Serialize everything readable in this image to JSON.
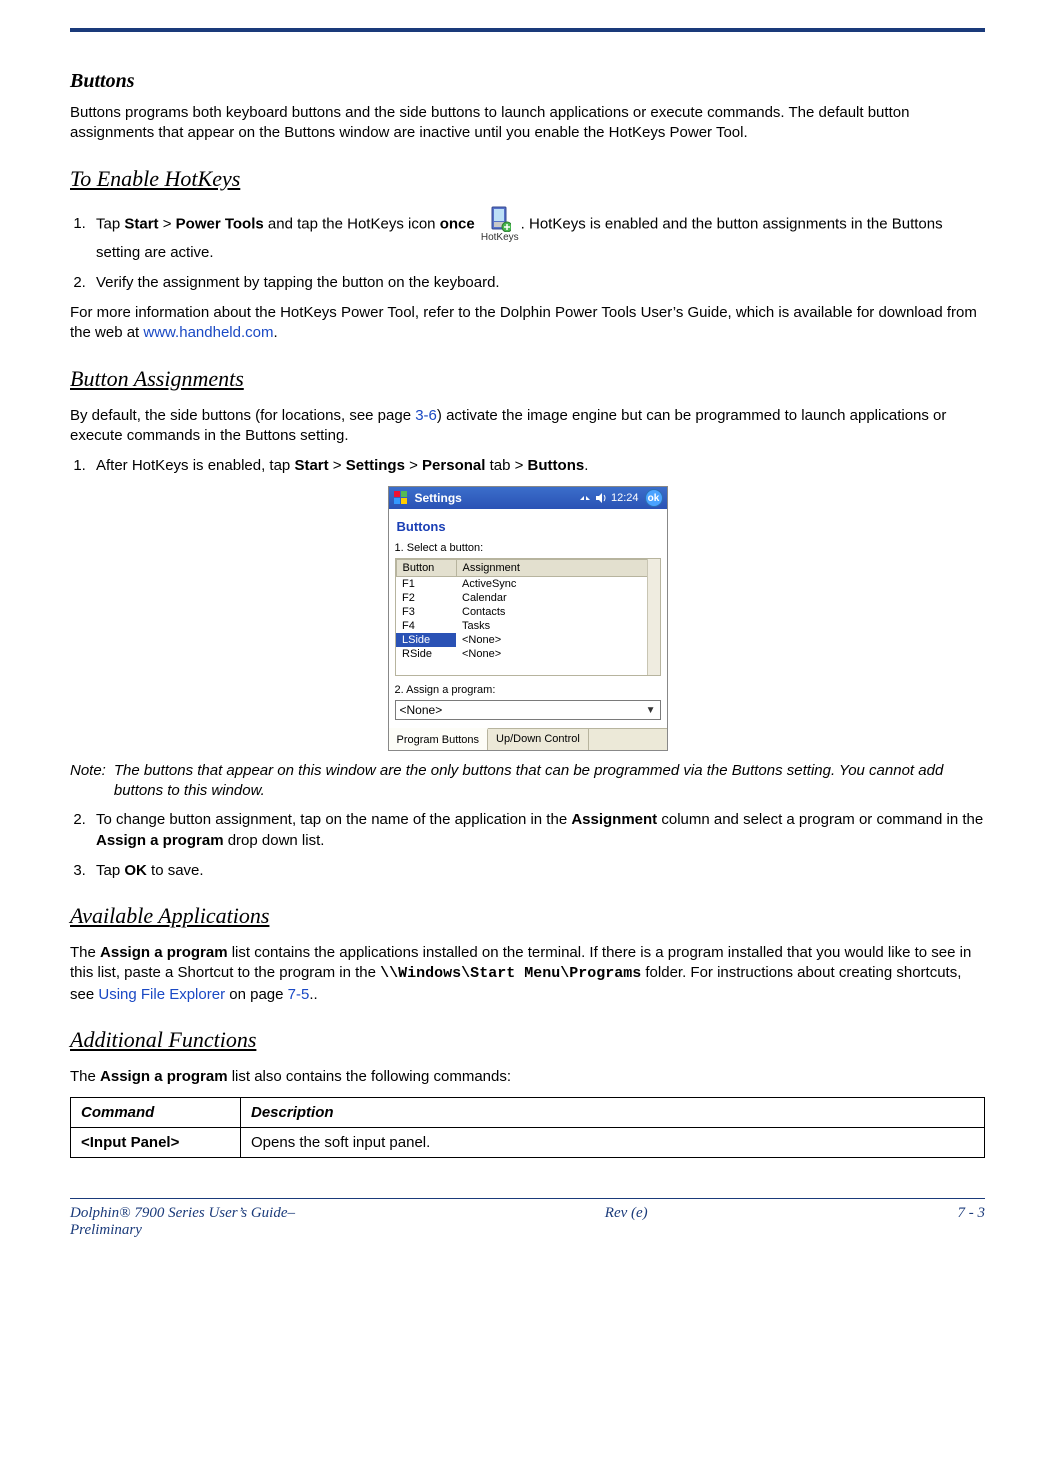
{
  "section_title": "Buttons",
  "intro": "Buttons programs both keyboard buttons and the side buttons  to launch applications or execute commands. The default button assignments that appear on the Buttons window are inactive until you enable the HotKeys Power Tool.",
  "enable_heading": "To Enable HotKeys",
  "enable_step1_a": "Tap ",
  "enable_step1_b": "Start",
  "enable_step1_c": " > ",
  "enable_step1_d": "Power Tools",
  "enable_step1_e": " and tap the HotKeys icon ",
  "enable_step1_f": "once",
  "enable_step1_g": " ",
  "enable_step1_h": ". HotKeys is enabled and the button assignments in the Buttons setting are active.",
  "hotkeys_label": "HotKeys",
  "enable_step2": "Verify the assignment by tapping the button on the keyboard.",
  "enable_more_a": "For more information about the HotKeys Power Tool, refer to the Dolphin Power Tools User’s Guide, which is available for download from the web at ",
  "enable_more_link": "www.handheld.com",
  "enable_more_b": ".",
  "assign_heading": "Button Assignments",
  "assign_intro_a": "By default, the side buttons (for locations, see page ",
  "assign_intro_link": "3-6",
  "assign_intro_b": ") activate the image engine but can be programmed to launch applications or execute commands in the Buttons setting.",
  "assign_step1_a": "After HotKeys is enabled, tap ",
  "assign_step1_b": "Start",
  "assign_step1_c": " > ",
  "assign_step1_d": "Settings",
  "assign_step1_e": " > ",
  "assign_step1_f": "Personal",
  "assign_step1_g": " tab > ",
  "assign_step1_h": "Buttons",
  "assign_step1_i": ".",
  "shot": {
    "window_title": "Settings",
    "time": "12:24",
    "ok": "ok",
    "heading": "Buttons",
    "step1_label": "1. Select a button:",
    "col_button": "Button",
    "col_assign": "Assignment",
    "rows": [
      {
        "b": "F1",
        "a": "ActiveSync"
      },
      {
        "b": "F2",
        "a": "Calendar"
      },
      {
        "b": "F3",
        "a": "Contacts"
      },
      {
        "b": "F4",
        "a": "Tasks"
      },
      {
        "b": "LSide",
        "a": "<None>",
        "sel": true
      },
      {
        "b": "RSide",
        "a": "<None>"
      }
    ],
    "step2_label": "2. Assign a program:",
    "dropdown_value": "<None>",
    "tab1": "Program Buttons",
    "tab2": "Up/Down Control"
  },
  "note_label": "Note:",
  "note_text": "The buttons that appear on this window are the only buttons that can be programmed via the Buttons setting. You cannot add buttons to this window.",
  "assign_step2_a": "To change button assignment, tap on the name of the application in the ",
  "assign_step2_b": "Assignment",
  "assign_step2_c": " column and select a program or command in the ",
  "assign_step2_d": "Assign a program",
  "assign_step2_e": " drop down list.",
  "assign_step3_a": "Tap ",
  "assign_step3_b": "OK",
  "assign_step3_c": " to save.",
  "avail_heading": "Available Applications",
  "avail_a": "The ",
  "avail_b": "Assign a program",
  "avail_c": " list contains the applications installed on the terminal. If there is a program installed that you would like to see in this list, paste a Shortcut to the program in the ",
  "avail_path": "\\\\Windows\\Start Menu\\Programs",
  "avail_d": " folder. For instructions about creating shortcuts, see ",
  "avail_link1": "Using File Explorer",
  "avail_e": " on page ",
  "avail_link2": "7-5",
  "avail_f": "..",
  "addfn_heading": "Additional Functions",
  "addfn_a": "The ",
  "addfn_b": "Assign a program",
  "addfn_c": " list also contains the following commands:",
  "table": {
    "h1": "Command",
    "h2": "Description",
    "r1c1": "<Input Panel>",
    "r1c2": "Opens the soft input panel."
  },
  "footer": {
    "left1": "Dolphin® 7900 Series User’s Guide–",
    "left2": "Preliminary",
    "mid": "Rev (e)",
    "right": "7 - 3"
  }
}
